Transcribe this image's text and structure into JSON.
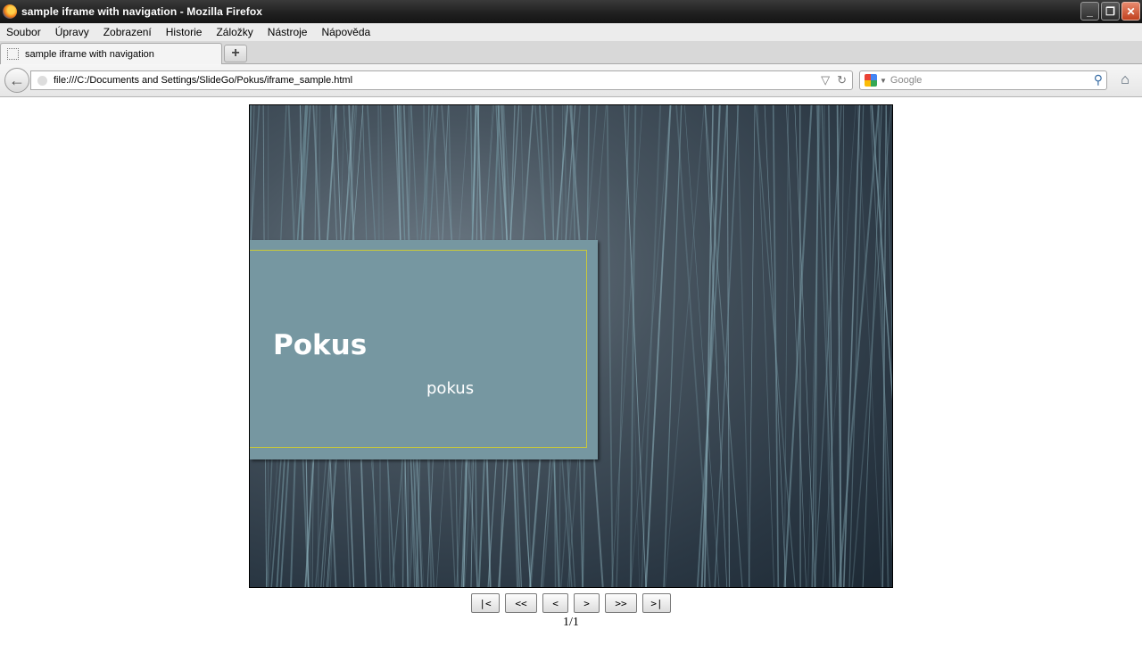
{
  "window": {
    "title": "sample iframe with navigation - Mozilla Firefox",
    "minimize": "_",
    "restore": "❐",
    "close": "✕"
  },
  "menu": [
    "Soubor",
    "Úpravy",
    "Zobrazení",
    "Historie",
    "Záložky",
    "Nástroje",
    "Nápověda"
  ],
  "tab": {
    "label": "sample iframe with navigation",
    "new_tab": "+"
  },
  "nav": {
    "back": "←",
    "url": "file:///C:/Documents and Settings/SlideGo/Pokus/iframe_sample.html",
    "dropdown": "▽",
    "reload": "↻",
    "search_placeholder": "Google",
    "search_icon": "⚲",
    "home": "⌂"
  },
  "slide": {
    "title": "Pokus",
    "subtitle": "pokus"
  },
  "controls": {
    "first": "|<",
    "prev_page": "<<",
    "prev": "<",
    "next": ">",
    "next_page": ">>",
    "last": ">|"
  },
  "counter": "1/1",
  "colors": {
    "slide_box": "#7697a1",
    "slide_border": "#c9c83a",
    "slide_background": "#2a3743"
  }
}
